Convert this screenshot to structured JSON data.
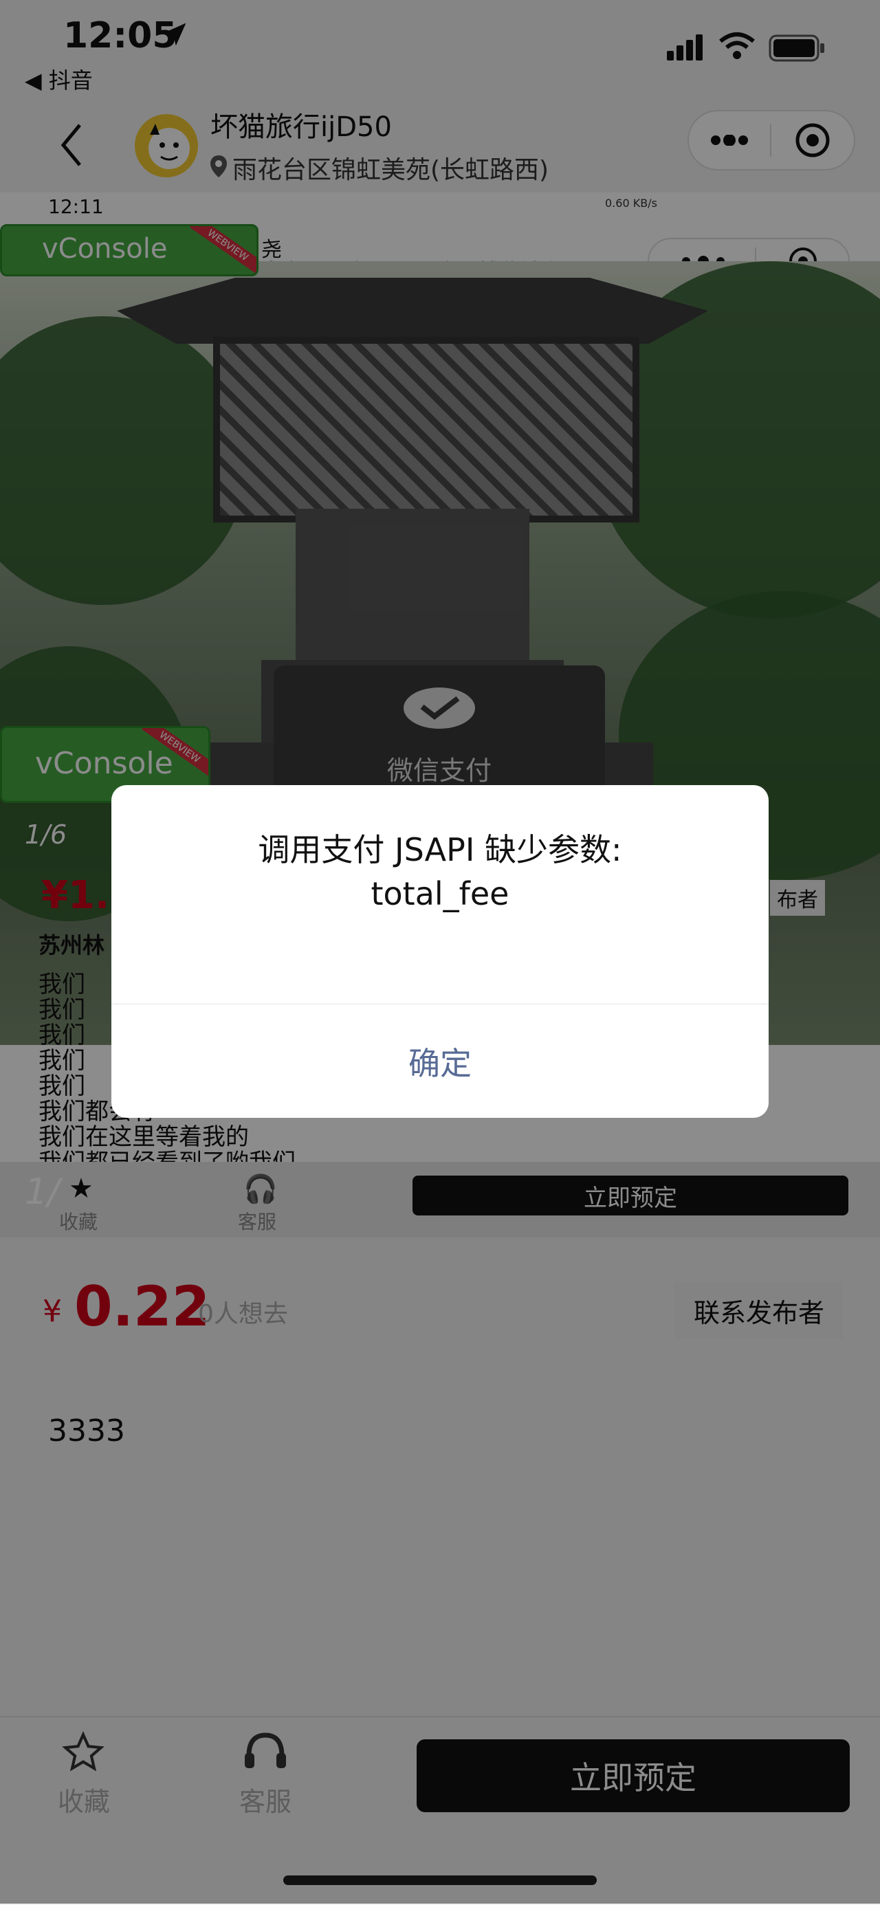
{
  "status": {
    "time": "12:05",
    "back_app": "◀ 抖音"
  },
  "header": {
    "title": "坏猫旅行ijD50",
    "subtitle": "雨花台区锦虹美苑(长虹路西)"
  },
  "inner": {
    "status_time": "12:11",
    "net_speed": "0.60 KB/s",
    "title_partial": "尧",
    "subtitle": "皋市CBD家居(月星家居博览城店)",
    "vconsole_label": "vConsole",
    "vconsole_ribbon": "WEBVIEW",
    "wechat_pay_label": "微信支付",
    "photo_counter": "1/6",
    "price_partial": "¥1.",
    "contact_partial": "布者",
    "shop_partial": "苏州林",
    "text_lines": [
      "我们",
      "我们",
      "我们",
      "我们",
      "我们",
      "我们都会有",
      "我们在这里等着我的",
      "我们都已经看到了哟我们"
    ],
    "bottom_collect": "收藏",
    "bottom_service": "客服",
    "bottom_book": "立即预定",
    "bottom_counter": "1/"
  },
  "main": {
    "price_symbol": "¥",
    "price": "0.22",
    "wants": "0人想去",
    "contact_button": "联系发布者",
    "description": "3333"
  },
  "bottom_bar": {
    "collect_label": "收藏",
    "service_label": "客服",
    "book_button": "立即预定"
  },
  "dialog": {
    "message_line1": "调用支付 JSAPI 缺少参数:",
    "message_line2": "total_fee",
    "ok_button": "确定"
  },
  "colors": {
    "price_red": "#d0021b",
    "dialog_button": "#576b95",
    "vconsole_green": "#46a843"
  }
}
